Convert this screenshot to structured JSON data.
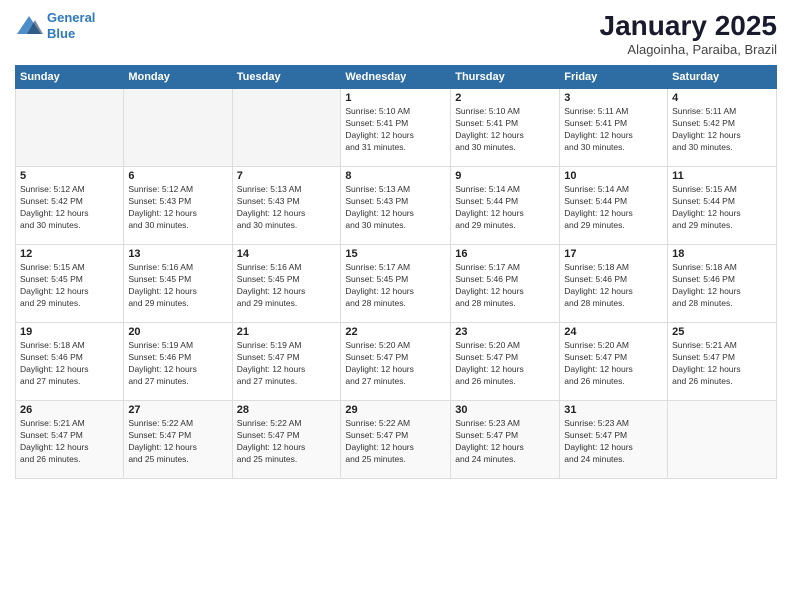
{
  "logo": {
    "line1": "General",
    "line2": "Blue"
  },
  "title": "January 2025",
  "location": "Alagoinha, Paraiba, Brazil",
  "weekdays": [
    "Sunday",
    "Monday",
    "Tuesday",
    "Wednesday",
    "Thursday",
    "Friday",
    "Saturday"
  ],
  "weeks": [
    [
      {
        "day": "",
        "info": ""
      },
      {
        "day": "",
        "info": ""
      },
      {
        "day": "",
        "info": ""
      },
      {
        "day": "1",
        "info": "Sunrise: 5:10 AM\nSunset: 5:41 PM\nDaylight: 12 hours\nand 31 minutes."
      },
      {
        "day": "2",
        "info": "Sunrise: 5:10 AM\nSunset: 5:41 PM\nDaylight: 12 hours\nand 30 minutes."
      },
      {
        "day": "3",
        "info": "Sunrise: 5:11 AM\nSunset: 5:41 PM\nDaylight: 12 hours\nand 30 minutes."
      },
      {
        "day": "4",
        "info": "Sunrise: 5:11 AM\nSunset: 5:42 PM\nDaylight: 12 hours\nand 30 minutes."
      }
    ],
    [
      {
        "day": "5",
        "info": "Sunrise: 5:12 AM\nSunset: 5:42 PM\nDaylight: 12 hours\nand 30 minutes."
      },
      {
        "day": "6",
        "info": "Sunrise: 5:12 AM\nSunset: 5:43 PM\nDaylight: 12 hours\nand 30 minutes."
      },
      {
        "day": "7",
        "info": "Sunrise: 5:13 AM\nSunset: 5:43 PM\nDaylight: 12 hours\nand 30 minutes."
      },
      {
        "day": "8",
        "info": "Sunrise: 5:13 AM\nSunset: 5:43 PM\nDaylight: 12 hours\nand 30 minutes."
      },
      {
        "day": "9",
        "info": "Sunrise: 5:14 AM\nSunset: 5:44 PM\nDaylight: 12 hours\nand 29 minutes."
      },
      {
        "day": "10",
        "info": "Sunrise: 5:14 AM\nSunset: 5:44 PM\nDaylight: 12 hours\nand 29 minutes."
      },
      {
        "day": "11",
        "info": "Sunrise: 5:15 AM\nSunset: 5:44 PM\nDaylight: 12 hours\nand 29 minutes."
      }
    ],
    [
      {
        "day": "12",
        "info": "Sunrise: 5:15 AM\nSunset: 5:45 PM\nDaylight: 12 hours\nand 29 minutes."
      },
      {
        "day": "13",
        "info": "Sunrise: 5:16 AM\nSunset: 5:45 PM\nDaylight: 12 hours\nand 29 minutes."
      },
      {
        "day": "14",
        "info": "Sunrise: 5:16 AM\nSunset: 5:45 PM\nDaylight: 12 hours\nand 29 minutes."
      },
      {
        "day": "15",
        "info": "Sunrise: 5:17 AM\nSunset: 5:45 PM\nDaylight: 12 hours\nand 28 minutes."
      },
      {
        "day": "16",
        "info": "Sunrise: 5:17 AM\nSunset: 5:46 PM\nDaylight: 12 hours\nand 28 minutes."
      },
      {
        "day": "17",
        "info": "Sunrise: 5:18 AM\nSunset: 5:46 PM\nDaylight: 12 hours\nand 28 minutes."
      },
      {
        "day": "18",
        "info": "Sunrise: 5:18 AM\nSunset: 5:46 PM\nDaylight: 12 hours\nand 28 minutes."
      }
    ],
    [
      {
        "day": "19",
        "info": "Sunrise: 5:18 AM\nSunset: 5:46 PM\nDaylight: 12 hours\nand 27 minutes."
      },
      {
        "day": "20",
        "info": "Sunrise: 5:19 AM\nSunset: 5:46 PM\nDaylight: 12 hours\nand 27 minutes."
      },
      {
        "day": "21",
        "info": "Sunrise: 5:19 AM\nSunset: 5:47 PM\nDaylight: 12 hours\nand 27 minutes."
      },
      {
        "day": "22",
        "info": "Sunrise: 5:20 AM\nSunset: 5:47 PM\nDaylight: 12 hours\nand 27 minutes."
      },
      {
        "day": "23",
        "info": "Sunrise: 5:20 AM\nSunset: 5:47 PM\nDaylight: 12 hours\nand 26 minutes."
      },
      {
        "day": "24",
        "info": "Sunrise: 5:20 AM\nSunset: 5:47 PM\nDaylight: 12 hours\nand 26 minutes."
      },
      {
        "day": "25",
        "info": "Sunrise: 5:21 AM\nSunset: 5:47 PM\nDaylight: 12 hours\nand 26 minutes."
      }
    ],
    [
      {
        "day": "26",
        "info": "Sunrise: 5:21 AM\nSunset: 5:47 PM\nDaylight: 12 hours\nand 26 minutes."
      },
      {
        "day": "27",
        "info": "Sunrise: 5:22 AM\nSunset: 5:47 PM\nDaylight: 12 hours\nand 25 minutes."
      },
      {
        "day": "28",
        "info": "Sunrise: 5:22 AM\nSunset: 5:47 PM\nDaylight: 12 hours\nand 25 minutes."
      },
      {
        "day": "29",
        "info": "Sunrise: 5:22 AM\nSunset: 5:47 PM\nDaylight: 12 hours\nand 25 minutes."
      },
      {
        "day": "30",
        "info": "Sunrise: 5:23 AM\nSunset: 5:47 PM\nDaylight: 12 hours\nand 24 minutes."
      },
      {
        "day": "31",
        "info": "Sunrise: 5:23 AM\nSunset: 5:47 PM\nDaylight: 12 hours\nand 24 minutes."
      },
      {
        "day": "",
        "info": ""
      }
    ]
  ]
}
